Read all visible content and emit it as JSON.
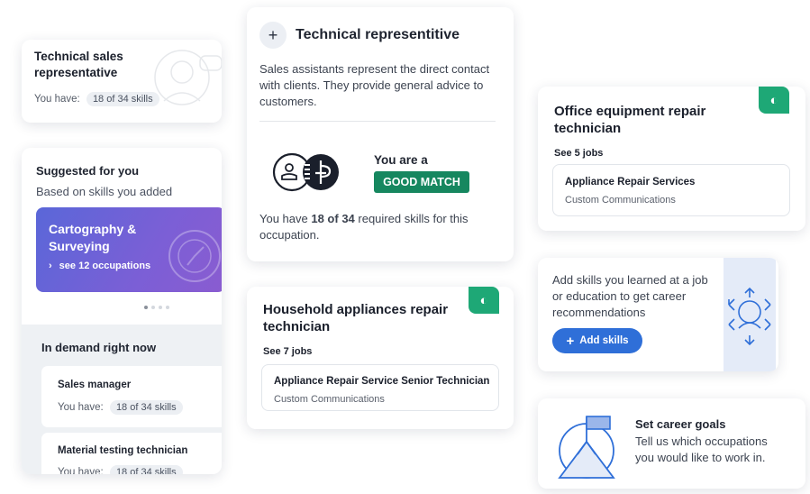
{
  "card1": {
    "title": "Technical sales representative",
    "have_label": "You have:",
    "skills": "18 of 34 skills"
  },
  "suggested": {
    "title": "Suggested for you",
    "subtitle": "Based on skills you added",
    "tile_title": "Cartography & Surveying",
    "tile_link": "see 12 occupations"
  },
  "in_demand": {
    "title": "In demand right now",
    "items": [
      {
        "title": "Sales manager",
        "have_label": "You have:",
        "skills": "18 of 34 skills"
      },
      {
        "title": "Material testing technician",
        "have_label": "You have:",
        "skills": "18 of 34 skills"
      }
    ]
  },
  "tech_rep": {
    "title": "Technical representitive",
    "description": "Sales assistants represent the direct contact with clients. They provide general advice to customers.",
    "you_are": "You are a",
    "badge": "GOOD MATCH",
    "skills_pre": "You have ",
    "skills_bold": "18 of 34",
    "skills_post": " required skills for this occupation."
  },
  "household": {
    "title": "Household appliances repair technician",
    "see_jobs": "See 7 jobs",
    "job_title": "Appliance Repair Service Senior Technician",
    "job_company": "Custom Communications"
  },
  "office": {
    "title": "Office equipment repair technician",
    "see_jobs": "See 5 jobs",
    "job_title": "Appliance Repair Services",
    "job_company": "Custom Communications"
  },
  "add_skills": {
    "text": "Add skills you learned at a job or education to get career recommendations",
    "button": "Add skills"
  },
  "goals": {
    "title": "Set career goals",
    "text": "Tell us which occupations you would like to work in."
  },
  "colors": {
    "accent_blue": "#2f6fd8",
    "green": "#1ea876",
    "purple": "#7b5fd6"
  }
}
